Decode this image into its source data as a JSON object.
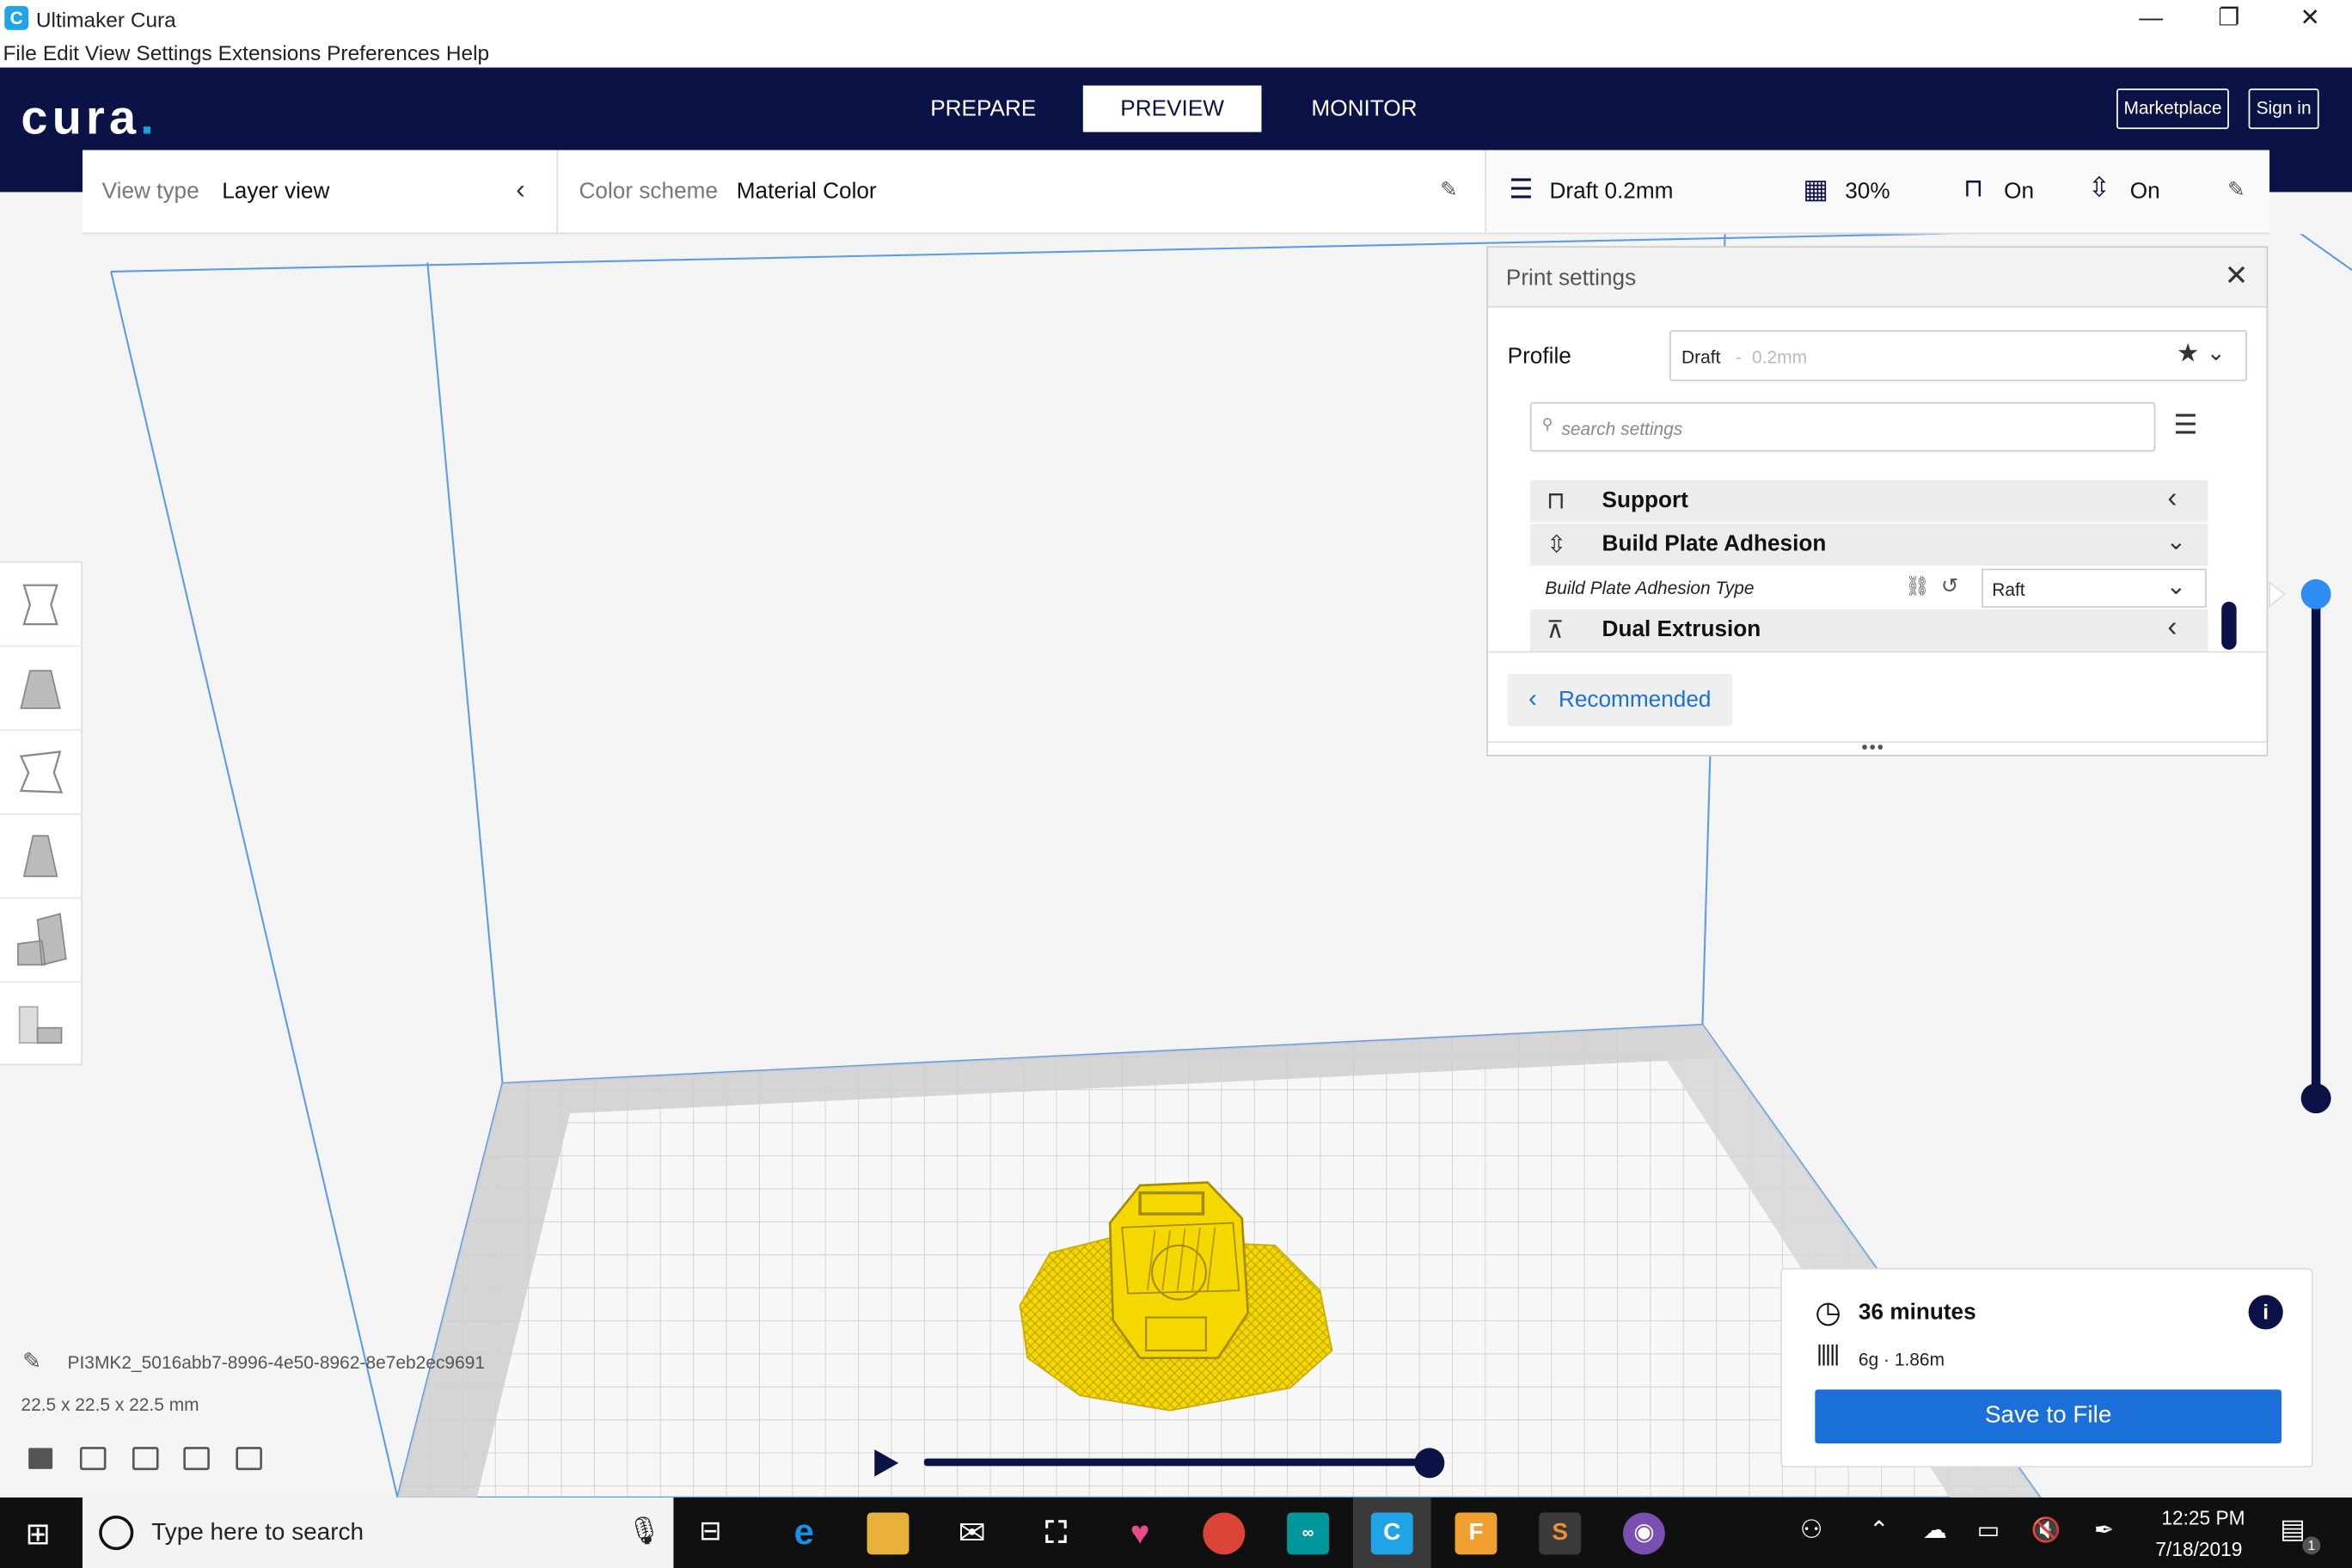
{
  "window": {
    "title": "Ultimaker Cura",
    "app_icon": "cura-app-icon",
    "minimize": "—",
    "maximize": "❐",
    "close": "✕"
  },
  "menu": [
    "File",
    "Edit",
    "View",
    "Settings",
    "Extensions",
    "Preferences",
    "Help"
  ],
  "header": {
    "logo": "cura",
    "tabs": [
      {
        "label": "PREPARE"
      },
      {
        "label": "PREVIEW",
        "active": true
      },
      {
        "label": "MONITOR"
      }
    ],
    "marketplace": "Marketplace",
    "signin": "Sign in"
  },
  "viewbar": {
    "view_type_label": "View type",
    "view_type_value": "Layer view",
    "color_scheme_label": "Color scheme",
    "color_scheme_value": "Material Color"
  },
  "settings_summary": {
    "profile": "Draft 0.2mm",
    "infill": "30%",
    "support": "On",
    "adhesion": "On"
  },
  "print_settings": {
    "title": "Print settings",
    "profile_label": "Profile",
    "profile_value": "Draft",
    "profile_layer": "0.2mm",
    "search_placeholder": "search settings",
    "categories": [
      {
        "label": "Support",
        "expanded": false
      },
      {
        "label": "Build Plate Adhesion",
        "expanded": true
      },
      {
        "label": "Dual Extrusion",
        "expanded": false
      }
    ],
    "adhesion_type_label": "Build Plate Adhesion Type",
    "adhesion_type_value": "Raft",
    "recommended_button": "Recommended"
  },
  "model_info": {
    "name": "PI3MK2_5016abb7-8996-4e50-8962-8e7eb2ec9691",
    "dimensions": "22.5 x 22.5 x 22.5 mm"
  },
  "print_info": {
    "time": "36 minutes",
    "material": "6g · 1.86m",
    "save_button": "Save to File"
  },
  "taskbar": {
    "search_placeholder": "Type here to search",
    "time": "12:25 PM",
    "date": "7/18/2019",
    "notifications": "1"
  },
  "colors": {
    "header_bg": "#0b1246",
    "accent_blue": "#1b6fd8",
    "model_yellow": "#f5d800",
    "slider_blue": "#2f8cf0"
  }
}
